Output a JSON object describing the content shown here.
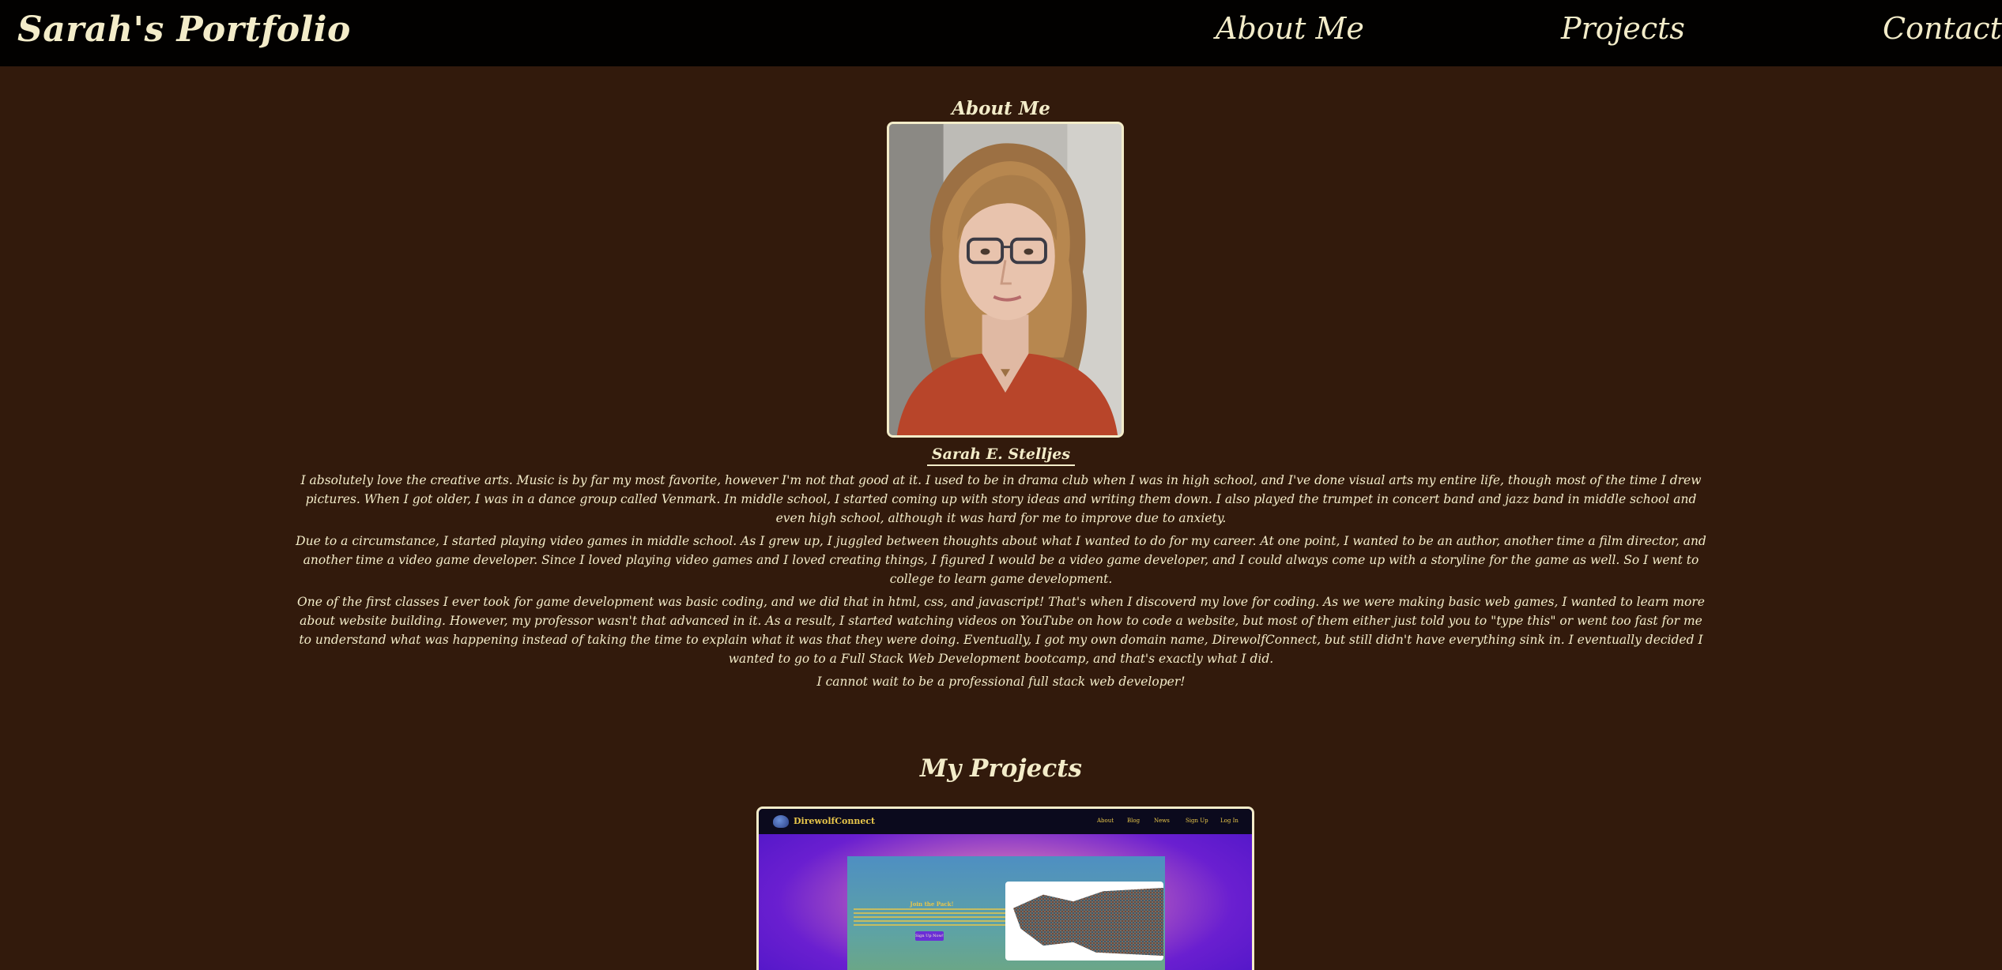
{
  "header": {
    "brand": "Sarah's Portfolio",
    "nav": {
      "about": "About Me",
      "projects": "Projects",
      "contact": "Contact"
    }
  },
  "about": {
    "heading": "About Me",
    "photo_alt": "Portrait of Sarah E. Stelljes",
    "name": "Sarah E. Stelljes",
    "paragraphs": [
      "I absolutely love the creative arts. Music is by far my most favorite, however I'm not that good at it. I used to be in drama club when I was in high school, and I've done visual arts my entire life, though most of the time I drew pictures. When I got older, I was in a dance group called Venmark. In middle school, I started coming up with story ideas and writing them down. I also played the trumpet in concert band and jazz band in middle school and even high school, although it was hard for me to improve due to anxiety.",
      "Due to a circumstance, I started playing video games in middle school. As I grew up, I juggled between thoughts about what I wanted to do for my career. At one point, I wanted to be an author, another time a film director, and another time a video game developer. Since I loved playing video games and I loved creating things, I figured I would be a video game developer, and I could always come up with a storyline for the game as well. So I went to college to learn game development.",
      "One of the first classes I ever took for game development was basic coding, and we did that in html, css, and javascript! That's when I discoverd my love for coding. As we were making basic web games, I wanted to learn more about website building. However, my professor wasn't that advanced in it. As a result, I started watching videos on YouTube on how to code a website, but most of them either just told you to \"type this\" or went too fast for me to understand what was happening instead of taking the time to explain what it was that they were doing. Eventually, I got my own domain name, DirewolfConnect, but still didn't have everything sink in. I eventually decided I wanted to go to a Full Stack Web Development bootcamp, and that's exactly what I did.",
      "I cannot wait to be a professional full stack web developer!"
    ]
  },
  "projects": {
    "heading": "My Projects",
    "items": [
      {
        "preview": {
          "brand": "DirewolfConnect",
          "nav": [
            "About",
            "Blog",
            "News",
            "Sign Up",
            "Log In"
          ],
          "hero_title": "Join the Pack!",
          "hero_button": "Sign Up Now!"
        }
      }
    ]
  },
  "colors": {
    "background": "#321a0c",
    "navbar": "#020100",
    "text": "#f3ecc9",
    "preview_accent": "#e8c64a"
  }
}
